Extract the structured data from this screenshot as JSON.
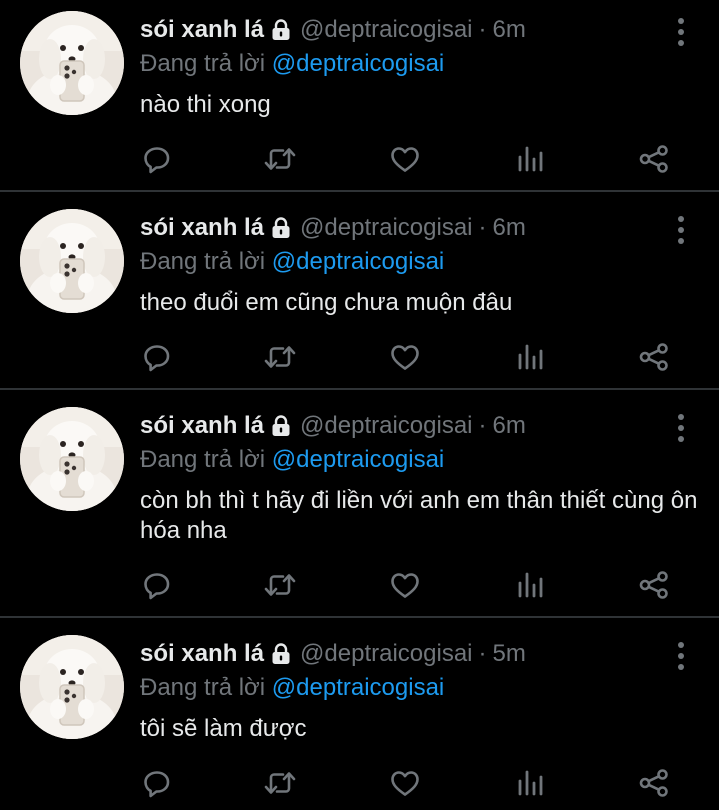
{
  "colors": {
    "background": "#000000",
    "text": "#e7e9ea",
    "muted": "#71767b",
    "mention": "#1d9bf0",
    "divider": "#2f3336"
  },
  "tweets": [
    {
      "name": "sói xanh lá",
      "handle": "@deptraicogisai",
      "separator": "·",
      "time": "6m",
      "reply_prefix": "Đang trả lời",
      "reply_to": "@deptraicogisai",
      "text": "nào thi xong",
      "icons": [
        "lock-icon",
        "more-icon",
        "reply-icon",
        "retweet-icon",
        "like-icon",
        "views-icon",
        "share-icon"
      ]
    },
    {
      "name": "sói xanh lá",
      "handle": "@deptraicogisai",
      "separator": "·",
      "time": "6m",
      "reply_prefix": "Đang trả lời",
      "reply_to": "@deptraicogisai",
      "text": "theo đuổi em cũng chưa muộn đâu",
      "icons": [
        "lock-icon",
        "more-icon",
        "reply-icon",
        "retweet-icon",
        "like-icon",
        "views-icon",
        "share-icon"
      ]
    },
    {
      "name": "sói xanh lá",
      "handle": "@deptraicogisai",
      "separator": "·",
      "time": "6m",
      "reply_prefix": "Đang trả lời",
      "reply_to": "@deptraicogisai",
      "text": "còn bh thì t hãy đi liền với anh em thân thiết cùng ôn hóa nha",
      "icons": [
        "lock-icon",
        "more-icon",
        "reply-icon",
        "retweet-icon",
        "like-icon",
        "views-icon",
        "share-icon"
      ]
    },
    {
      "name": "sói xanh lá",
      "handle": "@deptraicogisai",
      "separator": "·",
      "time": "5m",
      "reply_prefix": "Đang trả lời",
      "reply_to": "@deptraicogisai",
      "text": "tôi sẽ làm được",
      "icons": [
        "lock-icon",
        "more-icon",
        "reply-icon",
        "retweet-icon",
        "like-icon",
        "views-icon",
        "share-icon"
      ]
    }
  ]
}
